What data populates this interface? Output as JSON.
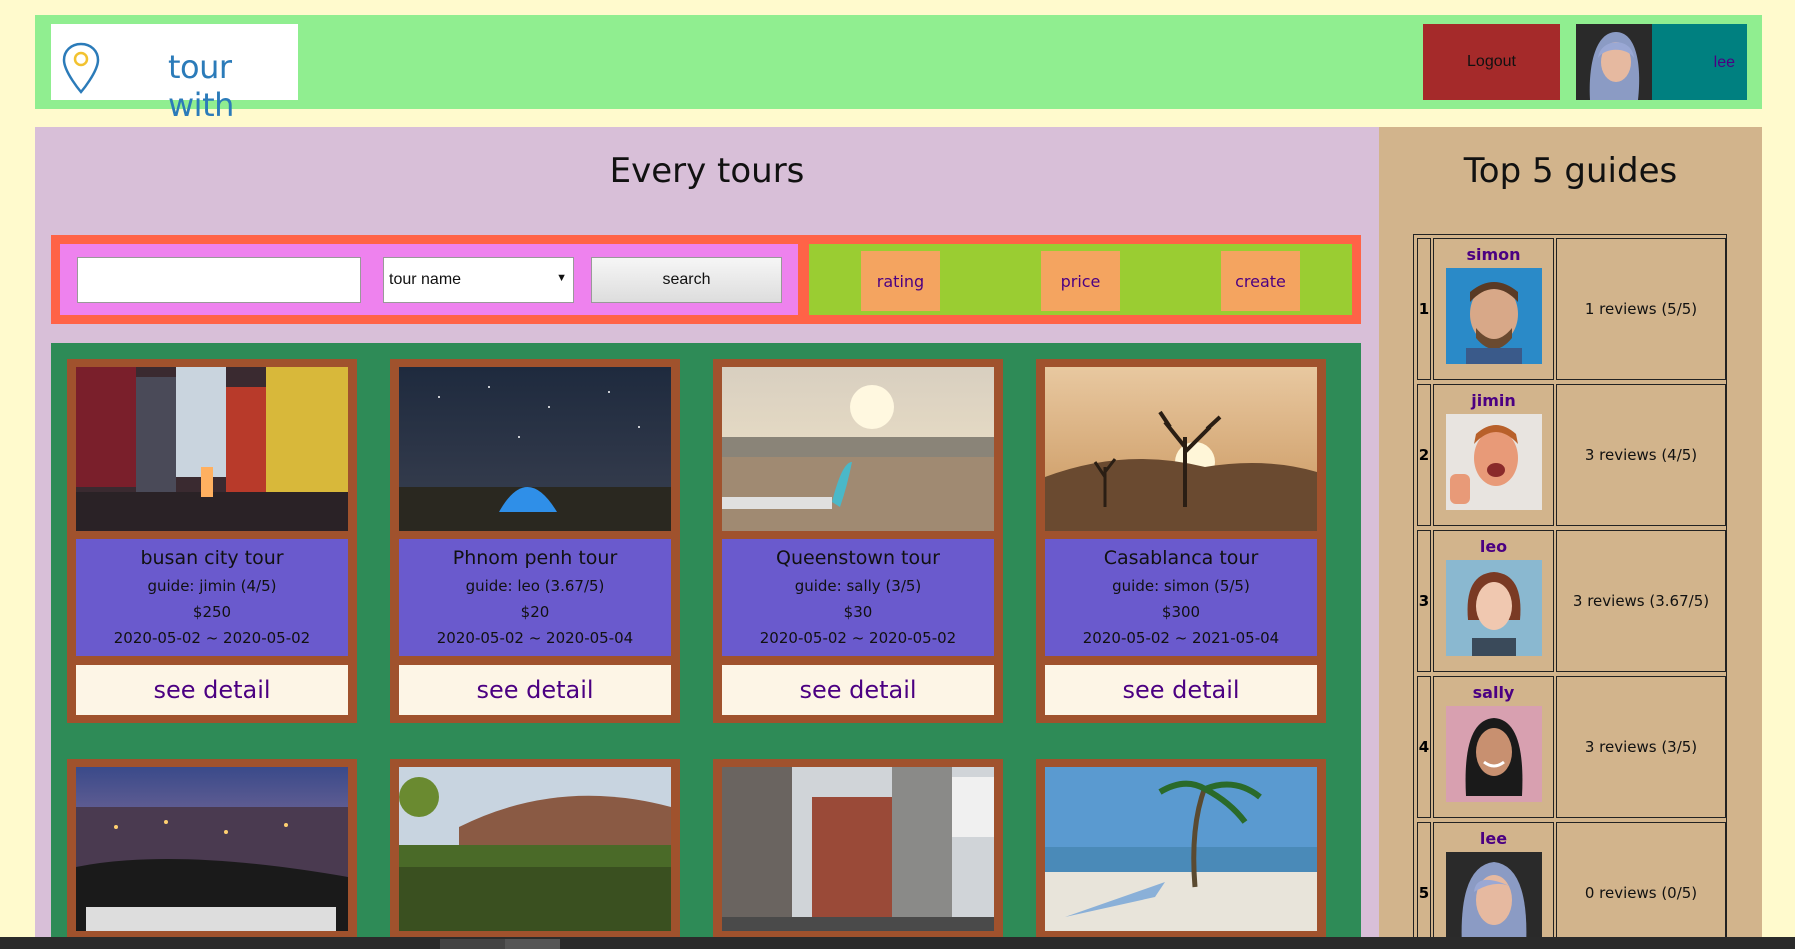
{
  "header": {
    "logo_text": "tour with",
    "logout_label": "Logout",
    "username": "lee"
  },
  "main": {
    "title": "Every tours",
    "search": {
      "input_value": "",
      "select_value": "tour name",
      "search_label": "search"
    },
    "sort": {
      "rating_label": "rating",
      "price_label": "price",
      "create_label": "create"
    },
    "tours": [
      {
        "name": "busan city tour",
        "guide": "guide: jimin (4/5)",
        "price": "$250",
        "dates": "2020-05-02 ~ 2020-05-02",
        "detail_label": "see detail",
        "image": "city-street-night"
      },
      {
        "name": "Phnom penh tour",
        "guide": "guide: leo (3.67/5)",
        "price": "$20",
        "dates": "2020-05-02 ~ 2020-05-04",
        "detail_label": "see detail",
        "image": "tent-starry-sky"
      },
      {
        "name": "Queenstown tour",
        "guide": "guide: sally (3/5)",
        "price": "$30",
        "dates": "2020-05-02 ~ 2020-05-02",
        "detail_label": "see detail",
        "image": "beach-sunset-surfboard"
      },
      {
        "name": "Casablanca tour",
        "guide": "guide: simon (5/5)",
        "price": "$300",
        "dates": "2020-05-02 ~ 2021-05-04",
        "detail_label": "see detail",
        "image": "desert-joshua-tree"
      },
      {
        "image": "city-lights-hollywood"
      },
      {
        "image": "vineyard-hills"
      },
      {
        "image": "city-buildings"
      },
      {
        "image": "beach-palm-boat"
      }
    ]
  },
  "sidebar": {
    "title": "Top 5 guides",
    "guides": [
      {
        "rank": "1",
        "name": "simon",
        "reviews": "1 reviews (5/5)"
      },
      {
        "rank": "2",
        "name": "jimin",
        "reviews": "3 reviews (4/5)"
      },
      {
        "rank": "3",
        "name": "leo",
        "reviews": "3 reviews (3.67/5)"
      },
      {
        "rank": "4",
        "name": "sally",
        "reviews": "3 reviews (3/5)"
      },
      {
        "rank": "5",
        "name": "lee",
        "reviews": "0 reviews (0/5)"
      }
    ]
  },
  "colors": {
    "page_bg": "#fffacd",
    "header_bg": "#90ee90",
    "logout_bg": "#a52a2a",
    "user_bg": "#008080",
    "main_bg": "#d8bfd8",
    "toolbar_bg": "#ff6347",
    "search_bg": "#ee82ee",
    "sort_bg": "#9acd32",
    "sort_btn_bg": "#f4a460",
    "grid_bg": "#2e8b57",
    "card_border": "#a0522d",
    "card_info_bg": "#6a5acd",
    "detail_bg": "#fdf5e6",
    "sidebar_bg": "#d2b48c"
  }
}
